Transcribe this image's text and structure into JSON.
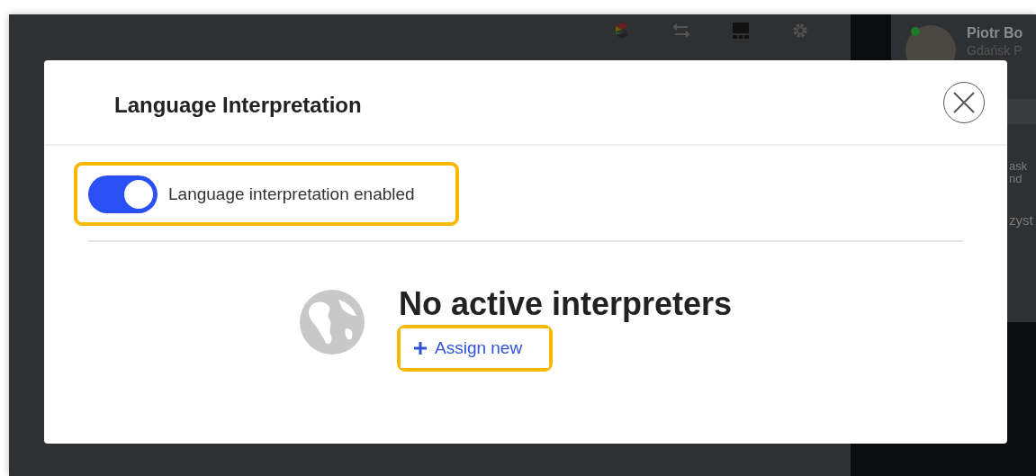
{
  "profile": {
    "name": "Piotr Bo",
    "subtitle": "Gdańsk P",
    "online": true
  },
  "background_texts": [
    "ask",
    "nd",
    "zyst"
  ],
  "dialog": {
    "title": "Language Interpretation",
    "toggle": {
      "label": "Language interpretation enabled",
      "on": true
    },
    "empty_state": {
      "title": "No active interpreters",
      "action": "Assign new"
    }
  }
}
